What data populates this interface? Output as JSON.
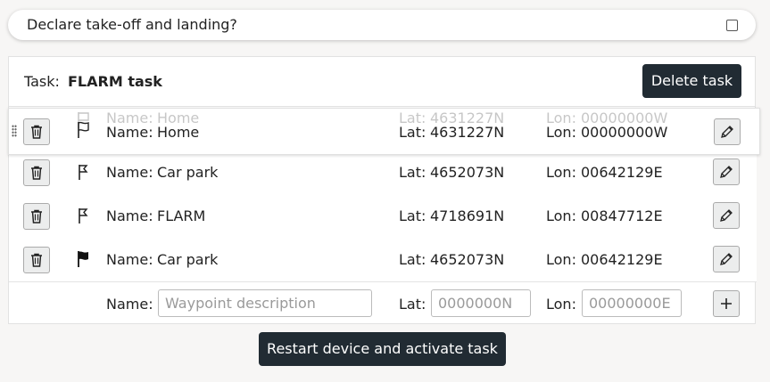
{
  "declare": {
    "label": "Declare take-off and landing?",
    "checked": false
  },
  "task": {
    "label": "Task:",
    "name": "FLARM task",
    "delete_label": "Delete task"
  },
  "labels": {
    "name": "Name:",
    "lat": "Lat:",
    "lon": "Lon:"
  },
  "waypoints": [
    {
      "name": "Home",
      "lat": "4631227N",
      "lon": "00000000W",
      "icon": "flag-outline-icon",
      "dragging": true
    },
    {
      "name": "Car park",
      "lat": "4652073N",
      "lon": "00642129E",
      "icon": "flag-small-outline-icon"
    },
    {
      "name": "FLARM",
      "lat": "4718691N",
      "lon": "00847712E",
      "icon": "flag-small-outline-icon"
    },
    {
      "name": "Car park",
      "lat": "4652073N",
      "lon": "00642129E",
      "icon": "flag-filled-icon"
    }
  ],
  "new_waypoint": {
    "name_placeholder": "Waypoint description",
    "lat_placeholder": "0000000N",
    "lon_placeholder": "00000000E"
  },
  "restart_label": "Restart device and activate task"
}
